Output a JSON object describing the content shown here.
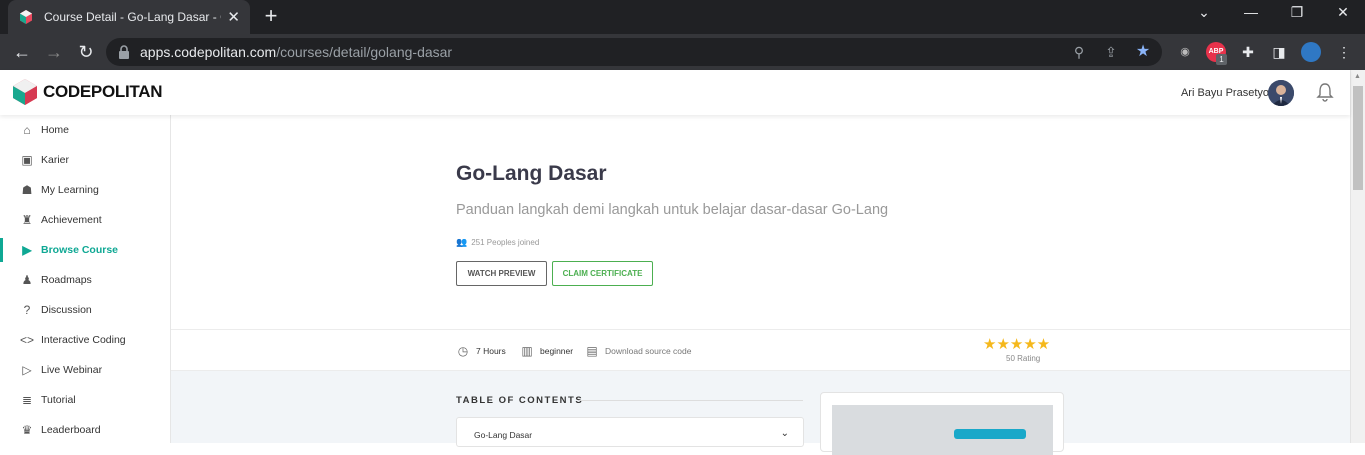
{
  "browser": {
    "tab_title": "Course Detail - Go-Lang Dasar - C",
    "tab_close": "✕",
    "new_tab": "+",
    "url_host": "apps.codepolitan.com",
    "url_path": "/courses/detail/golang-dasar",
    "ext_abp": "ABP",
    "ext_abp_badge": "1"
  },
  "header": {
    "logo_bold": "CODE",
    "logo_rest": "POLITAN",
    "user_name": "Ari Bayu Prasetyo"
  },
  "sidebar": {
    "items": [
      {
        "label": "Home",
        "icon": "home-icon",
        "glyph": "⌂"
      },
      {
        "label": "Karier",
        "icon": "briefcase-icon",
        "glyph": "▣"
      },
      {
        "label": "My Learning",
        "icon": "book-reader-icon",
        "glyph": "☗"
      },
      {
        "label": "Achievement",
        "icon": "award-icon",
        "glyph": "♜"
      },
      {
        "label": "Browse Course",
        "icon": "play-square-icon",
        "glyph": "▶"
      },
      {
        "label": "Roadmaps",
        "icon": "route-icon",
        "glyph": "♟"
      },
      {
        "label": "Discussion",
        "icon": "question-circle-icon",
        "glyph": "?"
      },
      {
        "label": "Interactive Coding",
        "icon": "code-icon",
        "glyph": "<>"
      },
      {
        "label": "Live Webinar",
        "icon": "video-icon",
        "glyph": "▷"
      },
      {
        "label": "Tutorial",
        "icon": "book-icon",
        "glyph": "≣"
      },
      {
        "label": "Leaderboard",
        "icon": "trophy-icon",
        "glyph": "♛"
      }
    ],
    "active_index": 4,
    "accent": "#0fa894"
  },
  "course": {
    "title": "Go-Lang Dasar",
    "subtitle": "Panduan langkah demi langkah untuk belajar dasar-dasar Go-Lang",
    "joined": "251 Peoples joined",
    "btn_preview": "WATCH PREVIEW",
    "btn_claim": "CLAIM CERTIFICATE"
  },
  "meta": {
    "duration": "7 Hours",
    "level": "beginner",
    "download": "Download source code",
    "stars": "★★★★★",
    "rating_value": 5,
    "rating_label": "50 Rating"
  },
  "toc": {
    "title": "TABLE OF CONTENTS",
    "first_item": "Go-Lang Dasar"
  },
  "colors": {
    "chrome_dark": "#202124",
    "chrome_tab": "#35363a",
    "claim_green": "#4caf50",
    "star_yellow": "#f5b81c",
    "accent": "#0fa894"
  }
}
